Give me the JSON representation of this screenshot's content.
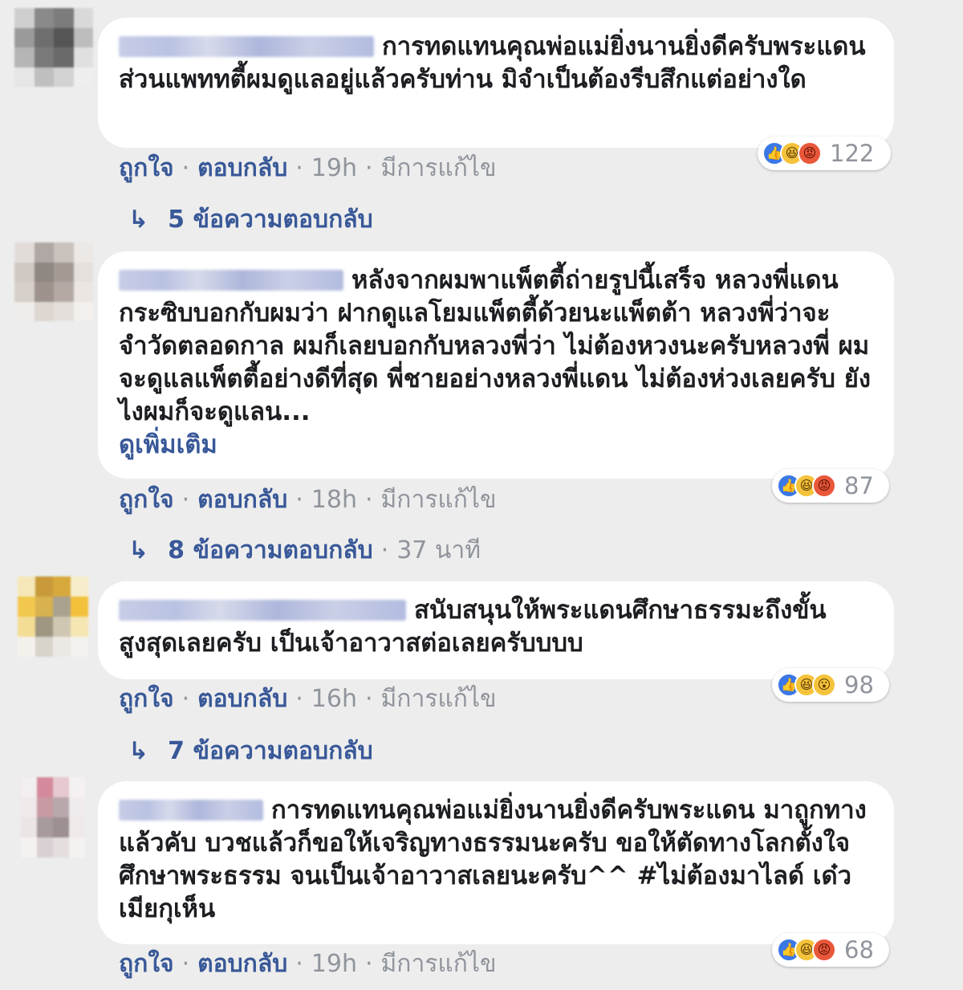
{
  "comments": [
    {
      "text": "การทดแทนคุณพ่อแม่ยิ่งนานยิ่งดีครับพระแดน ส่วนแพททตี้ผมดูแลอยู่แล้วครับท่าน มิจำเป็นต้องรีบสึกแต่อย่างใด",
      "see_more": "",
      "actions": {
        "like": "ถูกใจ",
        "reply": "ตอบกลับ",
        "time": "19h",
        "edited": "มีการแก้ไข"
      },
      "reaction_count": "122",
      "reaction_icons": [
        "like-icon",
        "haha-icon",
        "angry-icon"
      ],
      "replies": "5 ข้อความตอบกลับ",
      "reply_time": ""
    },
    {
      "text": "หลังจากผมพาแพ็ตตี้ถ่ายรูปนี้เสร็จ หลวงพี่แดนกระซิบบอกกับผมว่า ฝากดูแลโยมแพ็ตตี้ด้วยนะแพ็ตต้า หลวงพี่ว่าจะจำวัดตลอดกาล ผมก็เลยบอกกับหลวงพี่ว่า ไม่ต้องหวงนะครับหลวงพี่ ผมจะดูแลแพ็ตตี้อย่างดีที่สุด พี่ชายอย่างหลวงพี่แดน ไม่ต้องห่วงเลยครับ ยังไงผมก็จะดูแลน...",
      "see_more": "ดูเพิ่มเติม",
      "actions": {
        "like": "ถูกใจ",
        "reply": "ตอบกลับ",
        "time": "18h",
        "edited": "มีการแก้ไข"
      },
      "reaction_count": "87",
      "reaction_icons": [
        "like-icon",
        "haha-icon",
        "angry-icon"
      ],
      "replies": "8 ข้อความตอบกลับ",
      "reply_time": "37 นาที"
    },
    {
      "text": "สนับสนุนให้พระแดนศึกษาธรรมะถึงขั้นสูงสุดเลยครับ เป็นเจ้าอาวาสต่อเลยครับบบบ",
      "see_more": "",
      "actions": {
        "like": "ถูกใจ",
        "reply": "ตอบกลับ",
        "time": "16h",
        "edited": "มีการแก้ไข"
      },
      "reaction_count": "98",
      "reaction_icons": [
        "like-icon",
        "haha-icon",
        "wow-icon"
      ],
      "replies": "7 ข้อความตอบกลับ",
      "reply_time": ""
    },
    {
      "text": "การทดแทนคุณพ่อแม่ยิ่งนานยิ่งดีครับพระแดน มาถูกทางแล้วคับ บวชแล้วก็ขอให้เจริญทางธรรมนะครับ ขอให้ตัดทางโลกตั้งใจศึกษาพระธรรม จนเป็นเจ้าอาวาสเลยนะครับ^^ #ไม่ต้องมาไลด์ เด๋วเมียกุเห็น",
      "see_more": "",
      "actions": {
        "like": "ถูกใจ",
        "reply": "ตอบกลับ",
        "time": "19h",
        "edited": "มีการแก้ไข"
      },
      "reaction_count": "68",
      "reaction_icons": [
        "like-icon",
        "haha-icon",
        "angry-icon"
      ],
      "replies": "",
      "reply_time": ""
    }
  ],
  "symbols": {
    "dot": "·",
    "reply_arrow": "↳"
  },
  "colors": {
    "link": "#385898",
    "meta": "#90949c",
    "bubble": "#ffffff",
    "background": "#ededed"
  }
}
